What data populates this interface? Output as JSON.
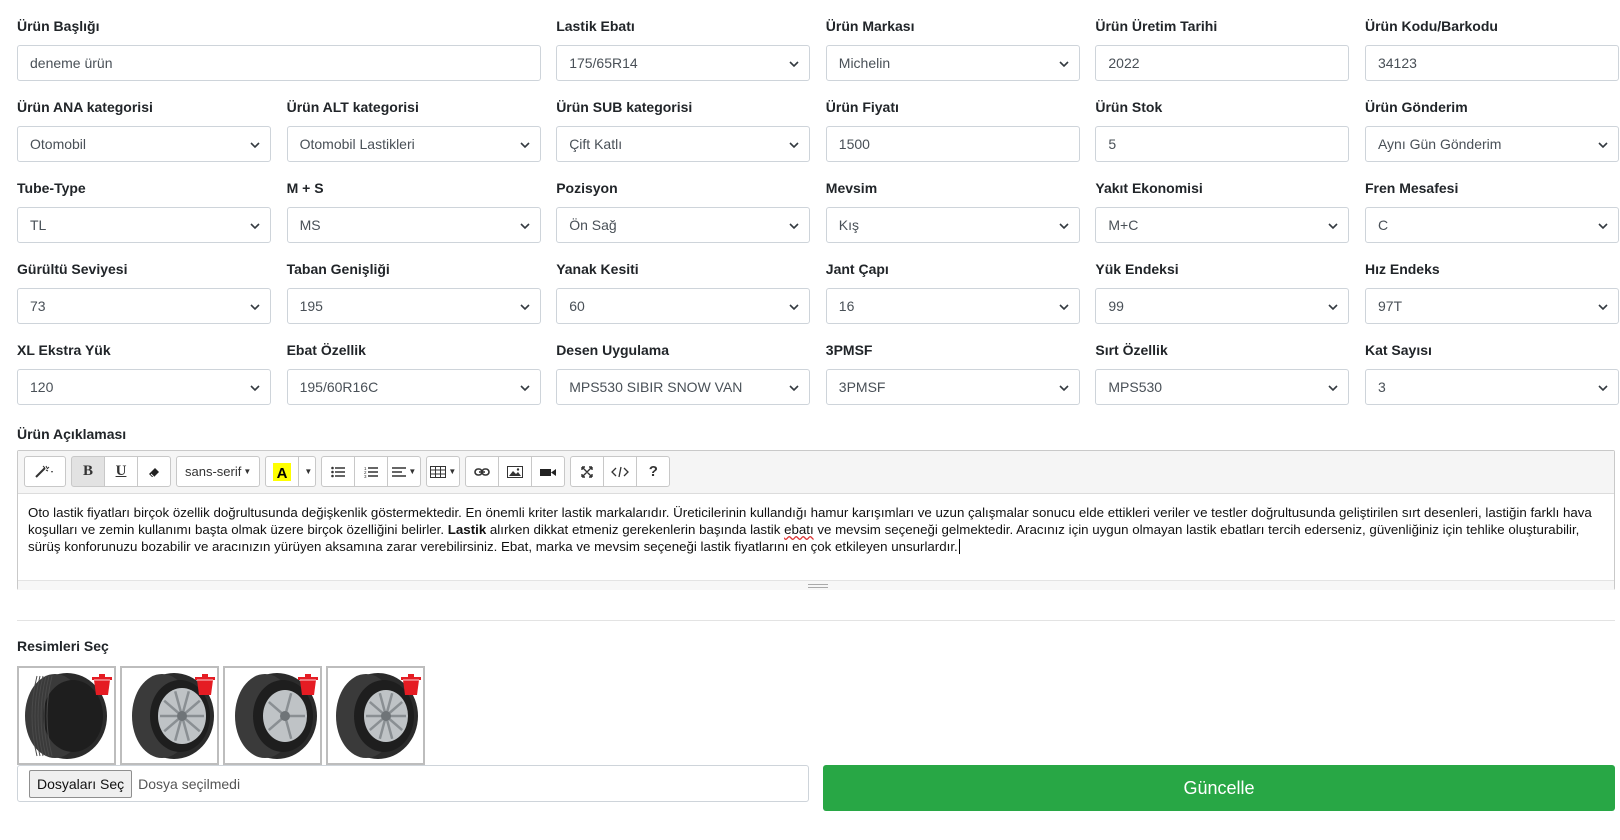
{
  "fields": [
    {
      "label": "Ürün Başlığı",
      "value": "deneme ürün",
      "type": "text"
    },
    {
      "label": "Lastik Ebatı",
      "value": "175/65R14",
      "type": "select"
    },
    {
      "label": "Ürün Markası",
      "value": "Michelin",
      "type": "select"
    },
    {
      "label": "Ürün Üretim Tarihi",
      "value": "2022",
      "type": "text"
    },
    {
      "label": "Ürün Kodu/Barkodu",
      "value": "34123",
      "type": "text"
    },
    {
      "label": "Ürün ANA kategorisi",
      "value": "Otomobil",
      "type": "select"
    },
    {
      "label": "Ürün ALT kategorisi",
      "value": "Otomobil Lastikleri",
      "type": "select"
    },
    {
      "label": "Ürün SUB kategorisi",
      "value": "Çift Katlı",
      "type": "select"
    },
    {
      "label": "Ürün Fiyatı",
      "value": "1500",
      "type": "text"
    },
    {
      "label": "Ürün Stok",
      "value": "5",
      "type": "text"
    },
    {
      "label": "Ürün Gönderim",
      "value": "Aynı Gün Gönderim",
      "type": "select"
    },
    {
      "label": "Tube-Type",
      "value": "TL",
      "type": "select"
    },
    {
      "label": "M + S",
      "value": "MS",
      "type": "select"
    },
    {
      "label": "Pozisyon",
      "value": "Ön Sağ",
      "type": "select"
    },
    {
      "label": "Mevsim",
      "value": "Kış",
      "type": "select"
    },
    {
      "label": "Yakıt Ekonomisi",
      "value": "M+C",
      "type": "select"
    },
    {
      "label": "Fren Mesafesi",
      "value": "C",
      "type": "select"
    },
    {
      "label": "Gürültü Seviyesi",
      "value": "73",
      "type": "select"
    },
    {
      "label": "Taban Genişliği",
      "value": "195",
      "type": "select"
    },
    {
      "label": "Yanak Kesiti",
      "value": "60",
      "type": "select"
    },
    {
      "label": "Jant Çapı",
      "value": "16",
      "type": "select"
    },
    {
      "label": "Yük Endeksi",
      "value": "99",
      "type": "select"
    },
    {
      "label": "Hız Endeks",
      "value": "97T",
      "type": "select"
    },
    {
      "label": "XL Ekstra Yük",
      "value": "120",
      "type": "select"
    },
    {
      "label": "Ebat Özellik",
      "value": "195/60R16C",
      "type": "select"
    },
    {
      "label": "Desen Uygulama",
      "value": "MPS530 SIBIR SNOW VAN",
      "type": "select"
    },
    {
      "label": "3PMSF",
      "value": "3PMSF",
      "type": "select"
    },
    {
      "label": "Sırt Özellik",
      "value": "MPS530",
      "type": "select"
    },
    {
      "label": "Kat Sayısı",
      "value": "3",
      "type": "select"
    }
  ],
  "description": {
    "label": "Ürün Açıklaması",
    "toolbar": {
      "font_name": "sans-serif",
      "bold": "B",
      "underline": "U",
      "help": "?"
    },
    "text_part1": "Oto lastik fiyatları birçok özellik doğrultusunda değişkenlik göstermektedir. En önemli kriter lastik markalarıdır. Üreticilerinin kullandığı hamur karışımları ve uzun çalışmalar sonucu elde ettikleri veriler ve testler doğrultusunda geliştirilen sırt desenleri, lastiğin farklı hava koşulları ve zemin kullanımı başta olmak üzere birçok özelliğini belirler. ",
    "text_bold": "Lastik",
    "text_part2": " alırken dikkat etmeniz gerekenlerin başında lastik ",
    "text_squiggle": "ebatı",
    "text_part3": " ve mevsim seçeneği gelmektedir. Aracınız için uygun olmayan lastik ebatları tercih ederseniz, güvenliğiniz için tehlike oluşturabilir, sürüş konforunuzu bozabilir ve aracınızın yürüyen aksamına zarar verebilirsiniz. Ebat, marka ve mevsim seçeneği lastik fiyatlarını en çok etkileyen unsurlardır."
  },
  "images": {
    "label": "Resimleri Seç",
    "count": 4
  },
  "file_input": {
    "button": "Dosyaları Seç",
    "status": "Dosya seçilmedi"
  },
  "submit": "Güncelle",
  "colors": {
    "submit": "#28a745",
    "trash": "#e51c23",
    "text_highlight": "#ffff00"
  }
}
